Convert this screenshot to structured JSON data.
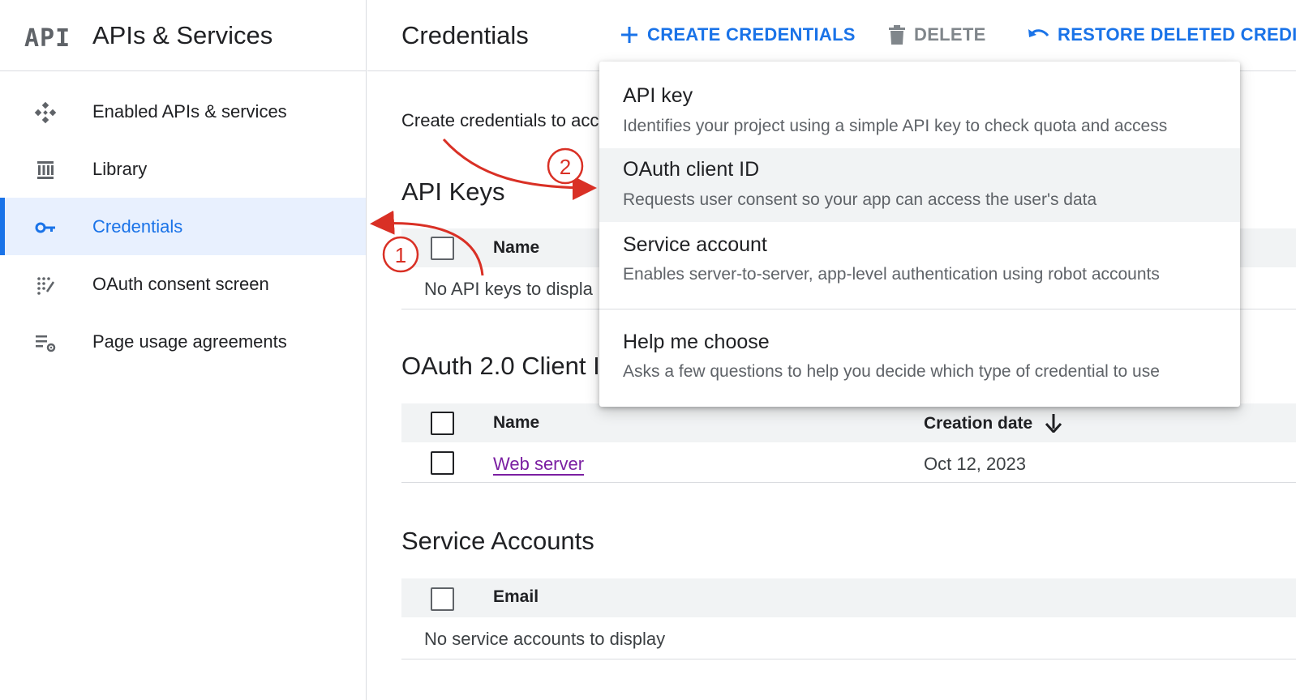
{
  "sidebar": {
    "logo": "API",
    "title": "APIs & Services",
    "items": [
      {
        "label": "Enabled APIs & services",
        "icon": "diamond-grid-icon"
      },
      {
        "label": "Library",
        "icon": "library-icon"
      },
      {
        "label": "Credentials",
        "icon": "key-icon",
        "active": true
      },
      {
        "label": "OAuth consent screen",
        "icon": "consent-icon"
      },
      {
        "label": "Page usage agreements",
        "icon": "settings-list-icon"
      }
    ]
  },
  "header": {
    "title": "Credentials",
    "create_label": "CREATE CREDENTIALS",
    "delete_label": "DELETE",
    "restore_label": "RESTORE DELETED CREDI"
  },
  "main": {
    "intro": "Create credentials to acc",
    "api_keys": {
      "title": "API Keys",
      "col_name": "Name",
      "empty": "No API keys to displa"
    },
    "oauth": {
      "title": "OAuth 2.0 Client I",
      "col_name": "Name",
      "col_date": "Creation date",
      "rows": [
        {
          "name": "Web server",
          "date": "Oct 12, 2023"
        }
      ]
    },
    "service_accounts": {
      "title": "Service Accounts",
      "col_email": "Email",
      "empty": "No service accounts to display"
    }
  },
  "dropdown": {
    "items": [
      {
        "title": "API key",
        "desc": "Identifies your project using a simple API key to check quota and access"
      },
      {
        "title": "OAuth client ID",
        "desc": "Requests user consent so your app can access the user's data"
      },
      {
        "title": "Service account",
        "desc": "Enables server-to-server, app-level authentication using robot accounts"
      },
      {
        "title": "Help me choose",
        "desc": "Asks a few questions to help you decide which type of credential to use"
      }
    ]
  },
  "annotations": {
    "step1": "1",
    "step2": "2",
    "color": "#d93025"
  },
  "colors": {
    "accent": "#1a73e8",
    "active_bg": "#e8f0fe",
    "link_visited": "#7b1fa2"
  }
}
